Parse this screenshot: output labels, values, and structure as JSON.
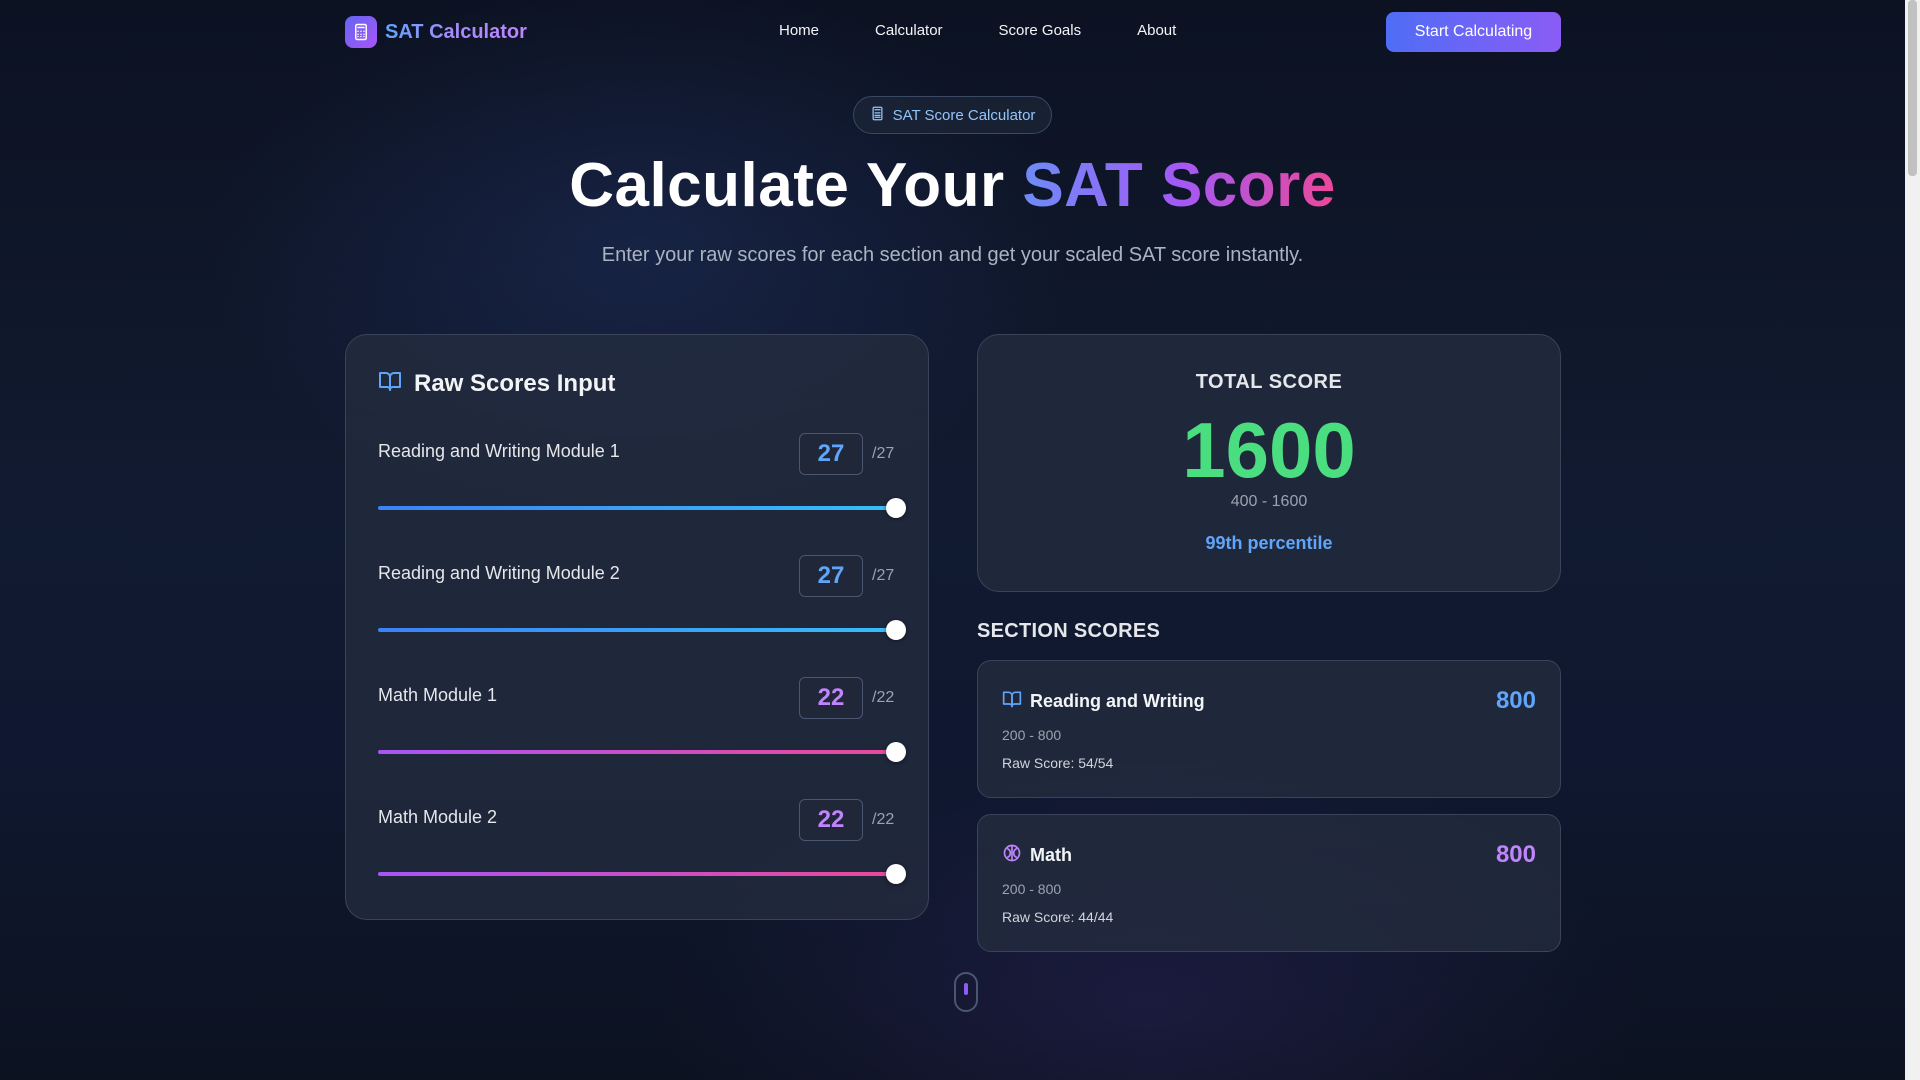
{
  "nav": {
    "logo_text": "SAT Calculator",
    "links": [
      "Home",
      "Calculator",
      "Score Goals",
      "About"
    ],
    "cta_label": "Start Calculating"
  },
  "hero": {
    "badge": "SAT Score Calculator",
    "title_plain": "Calculate Your ",
    "title_accent": "SAT Score",
    "subtitle": "Enter your raw scores for each section and get your scaled SAT score instantly."
  },
  "inputs": {
    "title": "Raw Scores Input",
    "rows": [
      {
        "label": "Reading and Writing Module 1",
        "value": "27",
        "max": "/27",
        "fraction": 1.0
      },
      {
        "label": "Reading and Writing Module 2",
        "value": "27",
        "max": "/27",
        "fraction": 1.0
      },
      {
        "label": "Math Module 1",
        "value": "22",
        "max": "/22",
        "fraction": 1.0
      },
      {
        "label": "Math Module 2",
        "value": "22",
        "max": "/22",
        "fraction": 1.0
      }
    ]
  },
  "total": {
    "label": "TOTAL SCORE",
    "value": "1600",
    "range": "400 - 1600",
    "percentile": "99th percentile"
  },
  "sections": {
    "title": "SECTION SCORES",
    "items": [
      {
        "name": "Reading and Writing",
        "score": "800",
        "range": "200 - 800",
        "raw": "Raw Score: 54/54"
      },
      {
        "name": "Math",
        "score": "800",
        "range": "200 - 800",
        "raw": "Raw Score: 44/44"
      }
    ]
  },
  "colors": {
    "accent_blue": "#60a5fa",
    "accent_purple": "#c084fc",
    "total_green": "#4ade80"
  },
  "icons": {
    "logo": "calculator-icon",
    "badge": "calculator-icon",
    "inputs": "book-open-icon",
    "reading": "book-open-icon",
    "math": "brain-icon"
  }
}
